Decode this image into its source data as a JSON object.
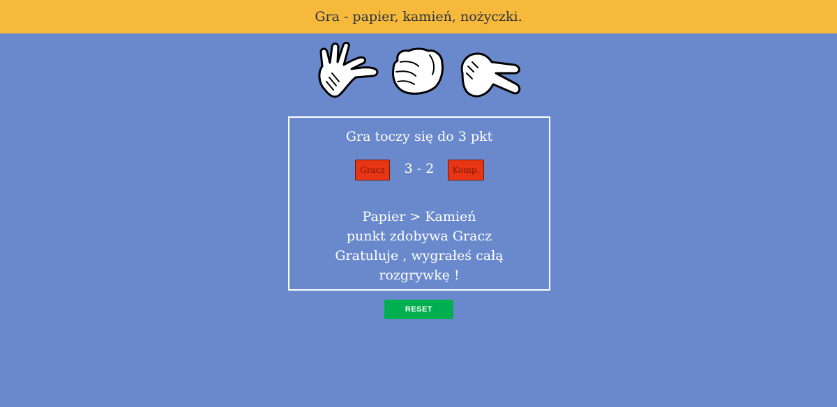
{
  "header": {
    "title": "Gra - papier, kamień, nożyczki."
  },
  "choices": [
    {
      "icon": "paper-hand-icon"
    },
    {
      "icon": "rock-fist-icon"
    },
    {
      "icon": "scissors-hand-icon"
    }
  ],
  "game": {
    "rule_text": "Gra toczy się do 3 pkt",
    "player_label": "Gracz",
    "computer_label": "Komp.",
    "score_text": "3 - 2",
    "messages": [
      "Papier > Kamień",
      "punkt zdobywa Gracz",
      "Gratuluje , wygrałeś całą",
      "rozgrywkę !"
    ]
  },
  "controls": {
    "reset_label": "RESET"
  },
  "colors": {
    "background": "#6a89cd",
    "header": "#f6b93b",
    "score_button": "#e83513",
    "reset_button": "#00b050"
  }
}
